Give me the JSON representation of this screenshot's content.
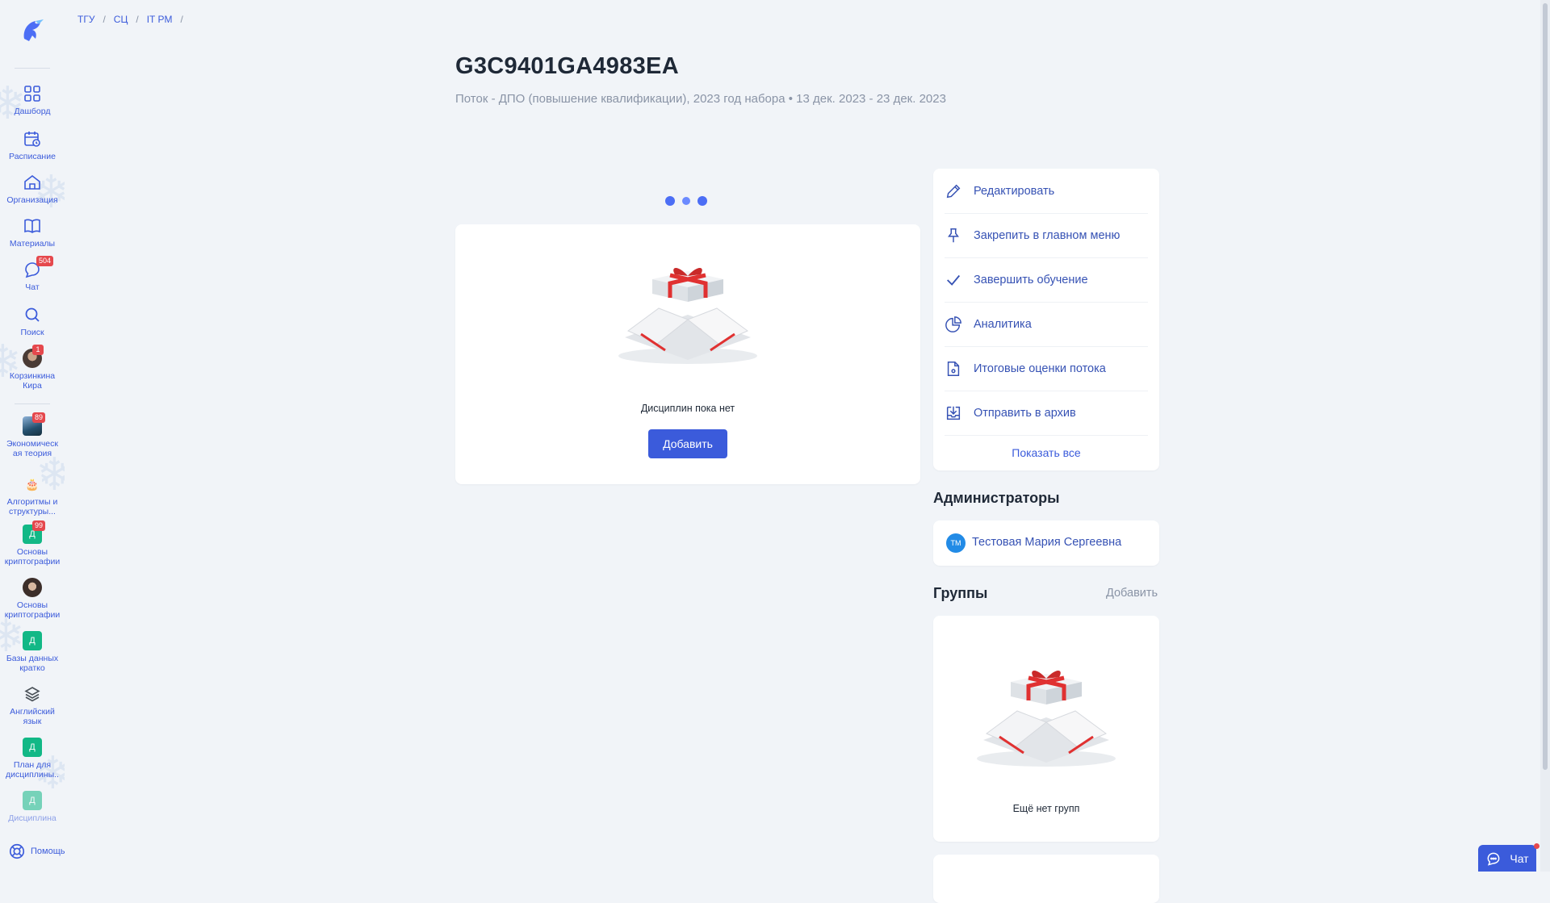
{
  "breadcrumb": [
    "ТГУ",
    "СЦ",
    "IT PM"
  ],
  "header": {
    "title": "G3C9401GA4983EA",
    "subtitle": "Поток - ДПО (повышение квалификации), 2023 год набора • 13 дек. 2023 - 23 дек. 2023"
  },
  "sidebar": {
    "nav": [
      {
        "label": "Дашборд",
        "icon": "dashboard-icon"
      },
      {
        "label": "Расписание",
        "icon": "calendar-icon"
      },
      {
        "label": "Организация",
        "icon": "home-icon"
      },
      {
        "label": "Материалы",
        "icon": "book-icon"
      },
      {
        "label": "Чат",
        "icon": "chat-icon",
        "badge": "504"
      },
      {
        "label": "Поиск",
        "icon": "search-icon"
      }
    ],
    "user": {
      "label": "Корзинкина Кира",
      "badge": "1"
    },
    "courses": [
      {
        "label": "Экономическ ая теория",
        "badge": "89",
        "thumb": "photo"
      },
      {
        "label": "Алгоритмы и структуры...",
        "thumb": "cake-icon"
      },
      {
        "label": "Основы криптографии",
        "badge": "99",
        "thumb": "Д"
      },
      {
        "label": "Основы криптографии",
        "thumb": "photo"
      },
      {
        "label": "Базы данных кратко",
        "thumb": "Д"
      },
      {
        "label": "Английский язык",
        "thumb": "layers-icon"
      },
      {
        "label": "План для дисциплины..",
        "thumb": "Д"
      },
      {
        "label": "Дисциплина",
        "thumb": "Д"
      }
    ],
    "help_label": "Помощь"
  },
  "disciplines": {
    "empty_text": "Дисциплин пока нет",
    "add_label": "Добавить"
  },
  "actions": {
    "items": [
      {
        "label": "Редактировать",
        "icon": "pencil-icon"
      },
      {
        "label": "Закрепить в главном меню",
        "icon": "pin-icon"
      },
      {
        "label": "Завершить обучение",
        "icon": "check-icon"
      },
      {
        "label": "Аналитика",
        "icon": "pie-chart-icon"
      },
      {
        "label": "Итоговые оценки потока",
        "icon": "document-icon"
      },
      {
        "label": "Отправить в архив",
        "icon": "archive-icon"
      }
    ],
    "show_all": "Показать все"
  },
  "admins": {
    "title": "Администраторы",
    "items": [
      {
        "initials": "ТМ",
        "name": "Тестовая Мария Сергеевна"
      }
    ]
  },
  "groups": {
    "title": "Группы",
    "add_label": "Добавить",
    "empty_text": "Ещё нет групп"
  },
  "chat_widget": {
    "label": "Чат"
  },
  "colors": {
    "accent": "#3b5bdb",
    "badge": "#e5484d",
    "background": "#f1f4f8",
    "teal": "#12b886"
  }
}
